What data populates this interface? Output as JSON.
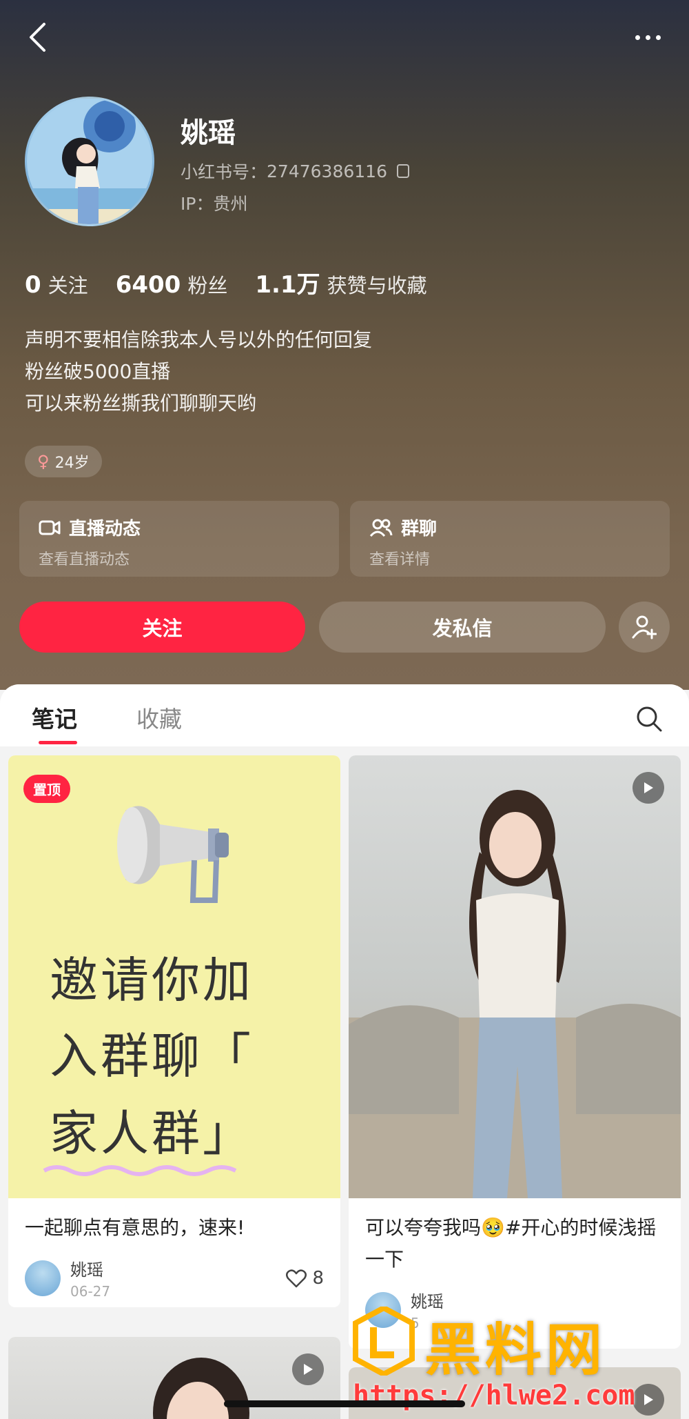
{
  "profile": {
    "name": "姚瑶",
    "id_label": "小红书号：",
    "id_value": "27476386116",
    "ip": "IP：贵州"
  },
  "stats": [
    {
      "num": "0",
      "label": "关注"
    },
    {
      "num": "6400",
      "label": "粉丝"
    },
    {
      "num": "1.1万",
      "label": "获赞与收藏"
    }
  ],
  "bio": [
    "声明不要相信除我本人号以外的任何回复",
    "粉丝破5000直播",
    "可以来粉丝撕我们聊聊天哟"
  ],
  "age_tag": "24岁",
  "cards": {
    "live": {
      "title": "直播动态",
      "sub": "查看直播动态"
    },
    "group": {
      "title": "群聊",
      "sub": "查看详情"
    }
  },
  "actions": {
    "follow": "关注",
    "message": "发私信"
  },
  "tabs": {
    "notes": "笔记",
    "favorites": "收藏"
  },
  "posts": [
    {
      "badge": "置顶",
      "image_text": [
        "邀请你加",
        "入群聊「",
        "家人群」"
      ],
      "title": "一起聊点有意思的，速来!",
      "author": "姚瑶",
      "date": "06-27",
      "likes": "8"
    },
    {
      "title": "可以夸夸我吗🥹#开心的时候浅摇一下",
      "author": "姚瑶",
      "date": "5"
    }
  ],
  "watermark": {
    "title": "黑料网",
    "url": "https://hlwe2.com"
  },
  "colors": {
    "accent": "#ff2442",
    "watermark_gold": "#ffb300",
    "watermark_red": "#ff3b3b"
  }
}
